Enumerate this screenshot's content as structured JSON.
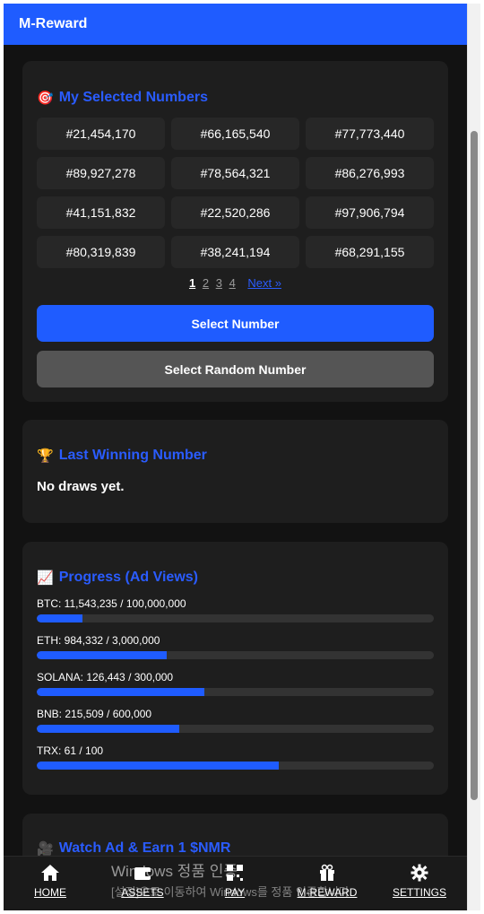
{
  "app": {
    "title": "M-Reward"
  },
  "selected": {
    "title": "My Selected Numbers",
    "emoji": "🎯",
    "numbers": [
      "#21,454,170",
      "#66,165,540",
      "#77,773,440",
      "#89,927,278",
      "#78,564,321",
      "#86,276,993",
      "#41,151,832",
      "#22,520,286",
      "#97,906,794",
      "#80,319,839",
      "#38,241,194",
      "#68,291,155"
    ],
    "pages": [
      "1",
      "2",
      "3",
      "4"
    ],
    "current_page": "1",
    "next_label": "Next »",
    "select_button": "Select Number",
    "random_button": "Select Random Number"
  },
  "winning": {
    "title": "Last Winning Number",
    "emoji": "🏆",
    "status": "No draws yet."
  },
  "progress": {
    "title": "Progress (Ad Views)",
    "emoji": "📈",
    "items": [
      {
        "label": "BTC: 11,543,235 / 100,000,000",
        "fraction": 0.1154
      },
      {
        "label": "ETH: 984,332 / 3,000,000",
        "fraction": 0.3281
      },
      {
        "label": "SOLANA: 126,443 / 300,000",
        "fraction": 0.4215
      },
      {
        "label": "BNB: 215,509 / 600,000",
        "fraction": 0.3592
      },
      {
        "label": "TRX: 61 / 100",
        "fraction": 0.61
      }
    ]
  },
  "watch": {
    "title": "Watch Ad & Earn 1 $NMR",
    "emoji": "🎥"
  },
  "nav": [
    {
      "label": "HOME",
      "icon": "home-icon"
    },
    {
      "label": "ASSETS",
      "icon": "wallet-icon"
    },
    {
      "label": "PAY",
      "icon": "qr-icon"
    },
    {
      "label": "M-REWARD",
      "icon": "gift-icon"
    },
    {
      "label": "SETTINGS",
      "icon": "gear-icon"
    }
  ],
  "overlay": {
    "line1": "Windows 정품 인증",
    "line2": "[설정]으로 이동하여 Windows를 정품 인증합니다."
  },
  "colors": {
    "accent": "#1f5cff",
    "background": "#121212",
    "card": "#1e1e1e"
  }
}
